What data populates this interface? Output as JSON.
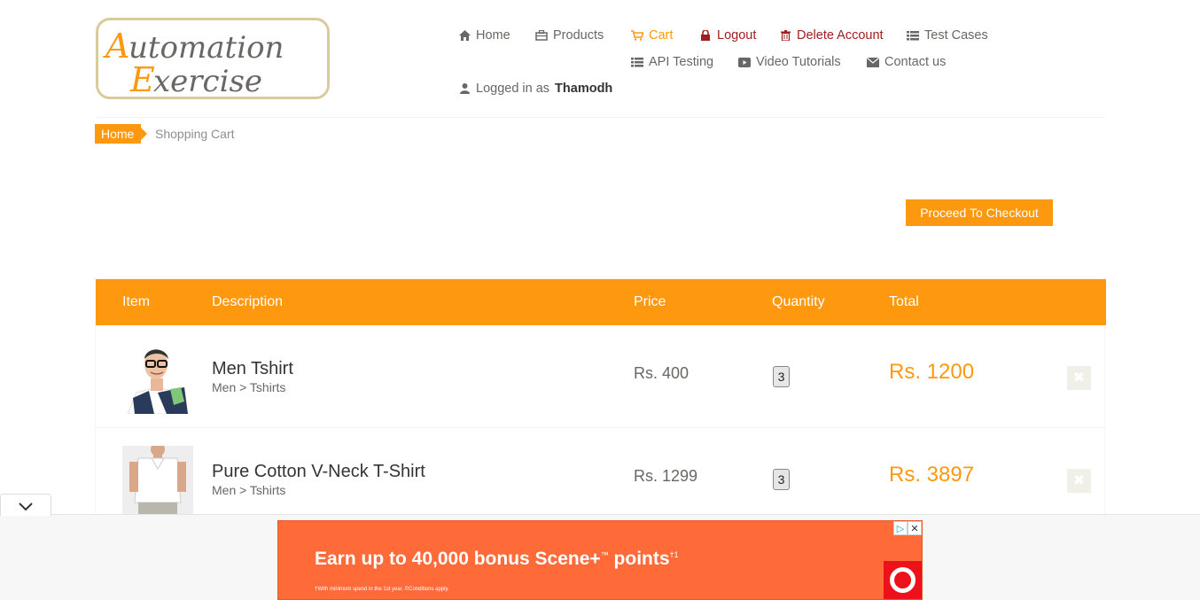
{
  "logo": {
    "line1": "Automation",
    "line2": "Exercise"
  },
  "nav": {
    "home": "Home",
    "products": "Products",
    "cart": "Cart",
    "logout": "Logout",
    "delete_account": "Delete Account",
    "test_cases": "Test Cases",
    "api_testing": "API Testing",
    "video_tutorials": "Video Tutorials",
    "contact_us": "Contact us",
    "logged_in_prefix": "Logged in as",
    "username": "Thamodh"
  },
  "breadcrumb": {
    "home": "Home",
    "current": "Shopping Cart"
  },
  "checkout_button": "Proceed To Checkout",
  "table": {
    "headers": {
      "item": "Item",
      "description": "Description",
      "price": "Price",
      "quantity": "Quantity",
      "total": "Total"
    },
    "rows": [
      {
        "name": "Men Tshirt",
        "category": "Men > Tshirts",
        "price": "Rs. 400",
        "quantity": "3",
        "total": "Rs. 1200"
      },
      {
        "name": "Pure Cotton V-Neck T-Shirt",
        "category": "Men > Tshirts",
        "price": "Rs. 1299",
        "quantity": "3",
        "total": "Rs. 3897"
      }
    ]
  },
  "ad": {
    "headline": "Earn up to 40,000 bonus Scene+",
    "tm": "™",
    "tail": " points",
    "footnote": "†1",
    "fine_print": "†With minimum spend in the 1st year. ©Conditions apply."
  },
  "colors": {
    "accent": "#FE980F",
    "danger": "#A02020",
    "ad_bg": "#FF6A39"
  }
}
